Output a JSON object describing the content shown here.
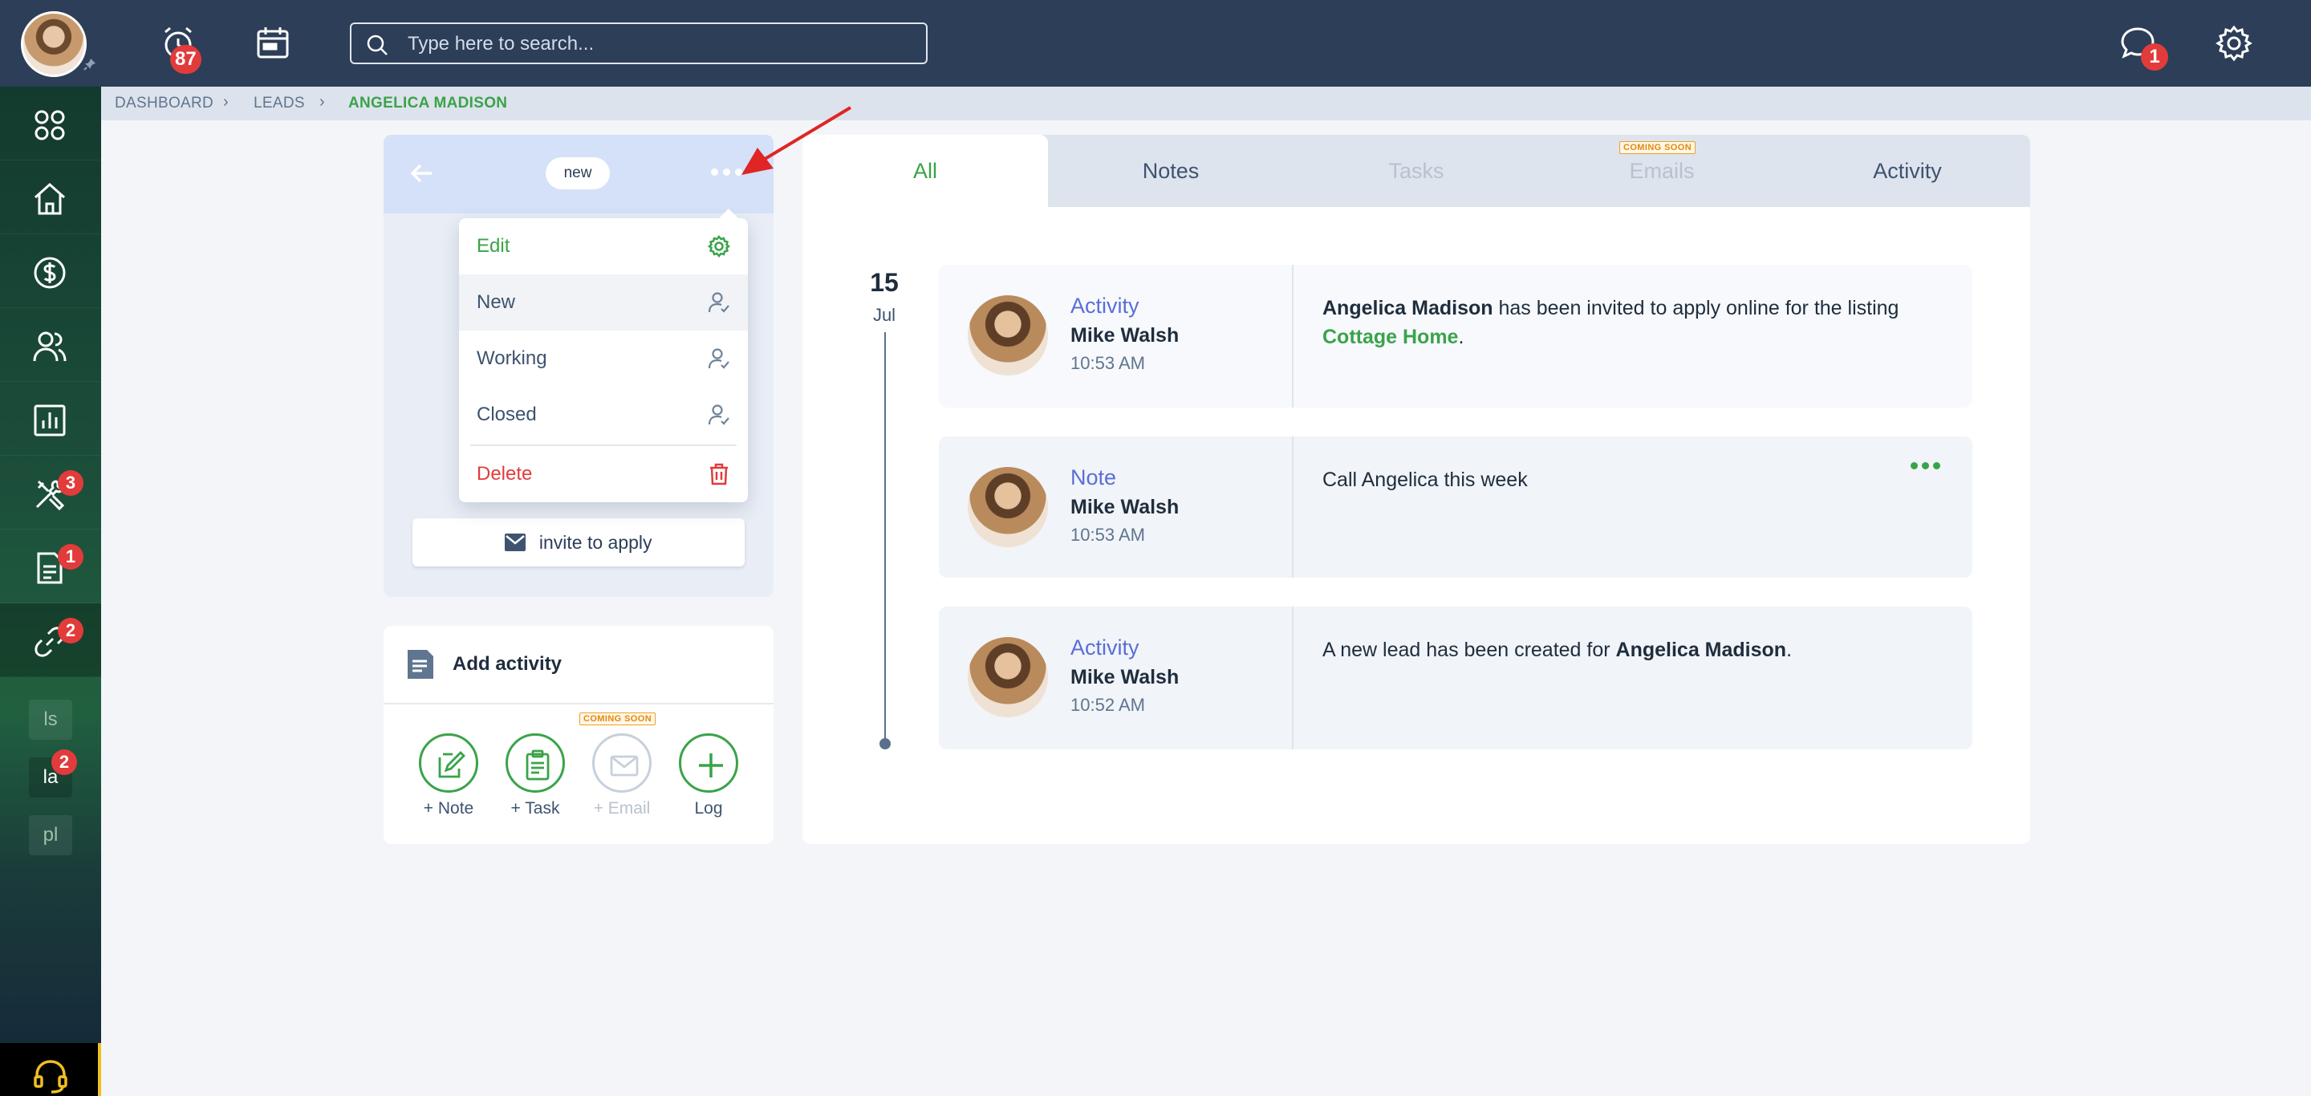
{
  "topbar": {
    "notifications_count": "87",
    "search_placeholder": "Type here to search...",
    "messages_count": "1"
  },
  "sidebar": {
    "badges": {
      "tools": "3",
      "documents": "1",
      "links": "2"
    },
    "sub_items": [
      {
        "label": "ls",
        "badge": ""
      },
      {
        "label": "la",
        "badge": "2"
      },
      {
        "label": "pl",
        "badge": ""
      }
    ]
  },
  "breadcrumb": {
    "items": [
      "DASHBOARD",
      "LEADS"
    ],
    "current": "ANGELICA MADISON"
  },
  "lead_card": {
    "status": "new",
    "invite_label": "invite to apply"
  },
  "dropdown": {
    "items": [
      "Edit",
      "New",
      "Working",
      "Closed",
      "Delete"
    ]
  },
  "add_activity": {
    "title": "Add activity",
    "coming_soon": "COMING SOON",
    "buttons": [
      "+ Note",
      "+ Task",
      "+ Email",
      "Log"
    ]
  },
  "tabs": {
    "items": [
      "All",
      "Notes",
      "Tasks",
      "Emails",
      "Activity"
    ],
    "coming_soon": "COMING SOON"
  },
  "timeline": {
    "day": "15",
    "month": "Jul",
    "entries": [
      {
        "type": "Activity",
        "author": "Mike Walsh",
        "time": "10:53 AM",
        "text_name": "Angelica Madison",
        "text_middle": " has been invited to apply online for the listing ",
        "text_link": "Cottage Home",
        "text_end": "."
      },
      {
        "type": "Note",
        "author": "Mike Walsh",
        "time": "10:53 AM",
        "text": "Call Angelica this week"
      },
      {
        "type": "Activity",
        "author": "Mike Walsh",
        "time": "10:52 AM",
        "text_start": "A new lead has been created for ",
        "text_name": "Angelica Madison",
        "text_end": "."
      }
    ]
  },
  "colors": {
    "topbar": "#2c3e58",
    "accent_green": "#3aa34a",
    "danger_red": "#e23b3b",
    "activity_blue": "#5b6ed6"
  }
}
